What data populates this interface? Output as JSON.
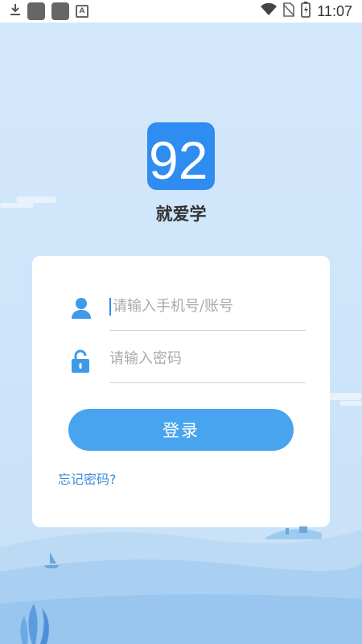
{
  "status_bar": {
    "time": "11:07",
    "icons": [
      "download-icon",
      "app-icon",
      "app-icon",
      "accessibility-icon",
      "wifi-icon",
      "no-sim-icon",
      "battery-icon"
    ]
  },
  "app": {
    "logo_number": "92",
    "name": "就爱学"
  },
  "login": {
    "username_placeholder": "请输入手机号/账号",
    "password_placeholder": "请输入密码",
    "login_button": "登录",
    "forgot_password": "忘记密码?"
  },
  "colors": {
    "accent": "#48a4ef",
    "logo_blue": "#2f8cf0",
    "link": "#3d8fd8",
    "background": "#d4e8fb"
  }
}
